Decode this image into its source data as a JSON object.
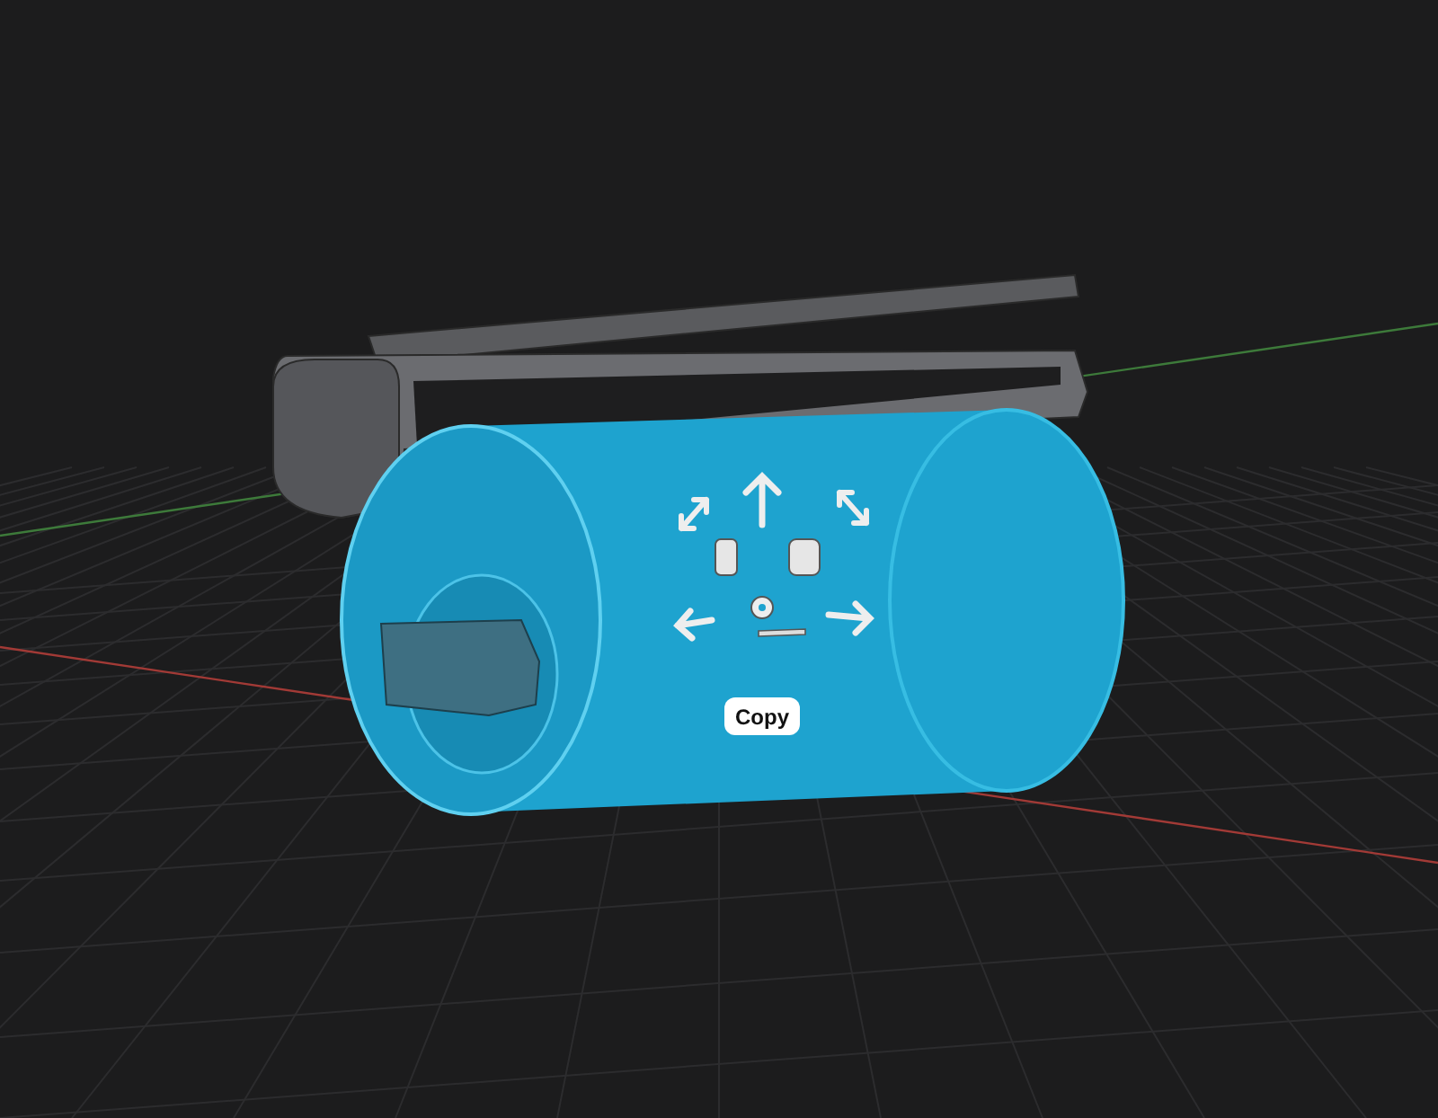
{
  "viewport": {
    "copy_button": "Copy"
  }
}
